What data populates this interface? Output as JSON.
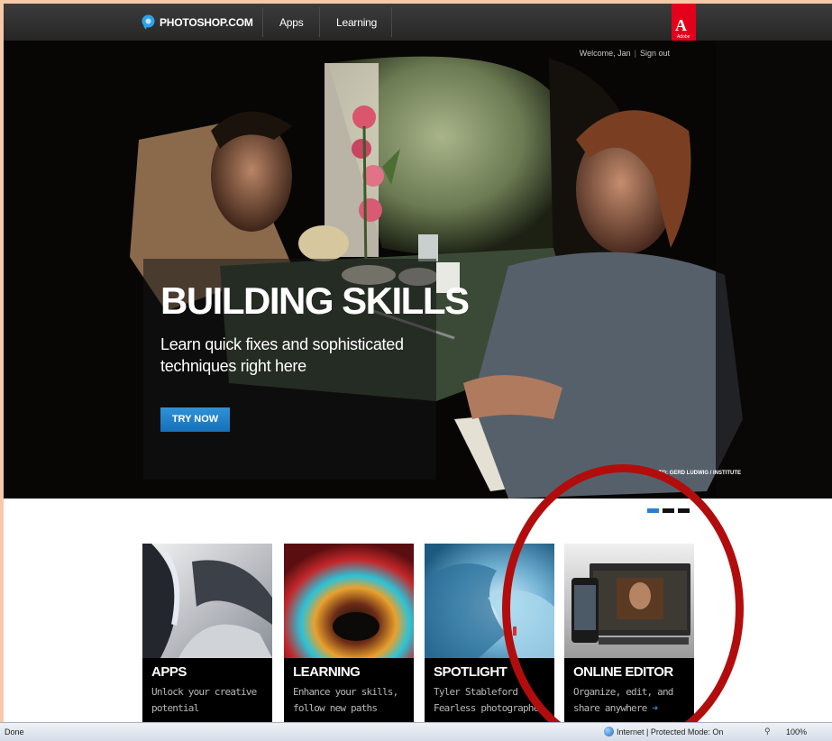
{
  "nav": {
    "brand": "PHOTOSHOP.COM",
    "items": [
      {
        "label": "Apps"
      },
      {
        "label": "Learning"
      }
    ],
    "adobe_letter": "A",
    "adobe_word": "Adobe"
  },
  "user": {
    "welcome": "Welcome, Jan",
    "sign_out": "Sign out"
  },
  "hero": {
    "title": "BUILDING SKILLS",
    "subtitle": "Learn quick fixes and sophisticated techniques right here",
    "cta": "TRY NOW",
    "credit": "PHOTO: GERD LUDWIG / INSTITUTE"
  },
  "tiles": [
    {
      "title": "APPS",
      "desc_line1": "Unlock your creative",
      "desc_line2": "potential"
    },
    {
      "title": "LEARNING",
      "desc_line1": "Enhance your skills,",
      "desc_line2": "follow new paths"
    },
    {
      "title": "SPOTLIGHT",
      "desc_line1": "Tyler Stableford",
      "desc_line2": "Fearless photographer"
    },
    {
      "title": "ONLINE EDITOR",
      "desc_line1": "Organize, edit, and",
      "desc_line2": "share anywhere"
    }
  ],
  "status": {
    "done": "Done",
    "zone": "Internet | Protected Mode: On",
    "zoom": "100%"
  },
  "colors": {
    "nav_bg": "#2e2e2e",
    "adobe_red": "#e4001b",
    "cta_blue": "#1f7fc8",
    "annotation_red": "#b20d0d",
    "frame": "#f6c9a8"
  }
}
